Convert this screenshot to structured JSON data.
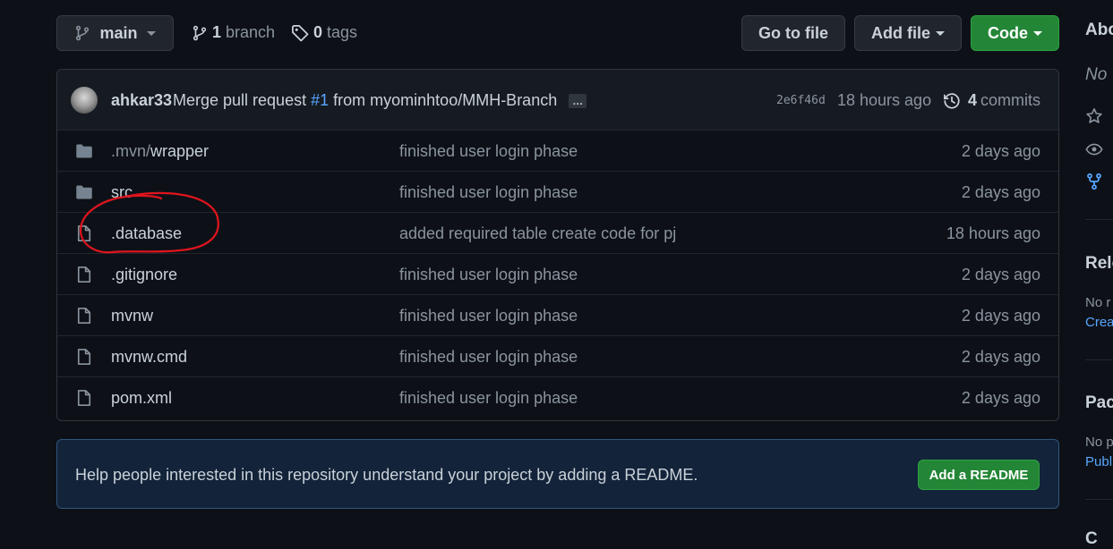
{
  "toolbar": {
    "branch_selector": "main",
    "branch_count": "1",
    "branch_label": "branch",
    "tag_count": "0",
    "tag_label": "tags",
    "go_to_file": "Go to file",
    "add_file": "Add file",
    "code": "Code"
  },
  "latest_commit": {
    "author": "ahkar33",
    "message_before": "Merge pull request",
    "pr_link": "#1",
    "message_after": "from myominhtoo/MMH-Branch",
    "ellipsis": "…",
    "sha": "2e6f46d",
    "time": "18 hours ago",
    "commit_count": "4",
    "commit_label": "commits"
  },
  "files": [
    {
      "type": "folder",
      "dim": ".mvn/",
      "name": "wrapper",
      "message": "finished user login phase",
      "time": "2 days ago"
    },
    {
      "type": "folder",
      "dim": "",
      "name": "src",
      "message": "finished user login phase",
      "time": "2 days ago"
    },
    {
      "type": "file",
      "dim": "",
      "name": ".database",
      "message": "added required table create code for pj",
      "time": "18 hours ago"
    },
    {
      "type": "file",
      "dim": "",
      "name": ".gitignore",
      "message": "finished user login phase",
      "time": "2 days ago"
    },
    {
      "type": "file",
      "dim": "",
      "name": "mvnw",
      "message": "finished user login phase",
      "time": "2 days ago"
    },
    {
      "type": "file",
      "dim": "",
      "name": "mvnw.cmd",
      "message": "finished user login phase",
      "time": "2 days ago"
    },
    {
      "type": "file",
      "dim": "",
      "name": "pom.xml",
      "message": "finished user login phase",
      "time": "2 days ago"
    }
  ],
  "readme_banner": {
    "text": "Help people interested in this repository understand your project by adding a README.",
    "button": "Add a README"
  },
  "sidebar": {
    "about_heading": "Abo",
    "about_text": "No",
    "releases_heading": "Rele",
    "releases_text": "No r",
    "releases_link": "Crea",
    "packages_heading": "Pac",
    "packages_text": "No p",
    "packages_link": "Publ",
    "contributors_heading": "C"
  },
  "colors": {
    "background": "#0d1117",
    "accent_green": "#238636",
    "link_blue": "#58a6ff",
    "annotation_red": "#e0141e"
  },
  "icons": {
    "branch": "git-branch-icon",
    "tag": "tag-icon",
    "history": "history-icon",
    "folder": "folder-icon",
    "file": "file-icon",
    "star": "star-icon",
    "eye": "eye-icon",
    "fork": "repo-forked-icon"
  }
}
